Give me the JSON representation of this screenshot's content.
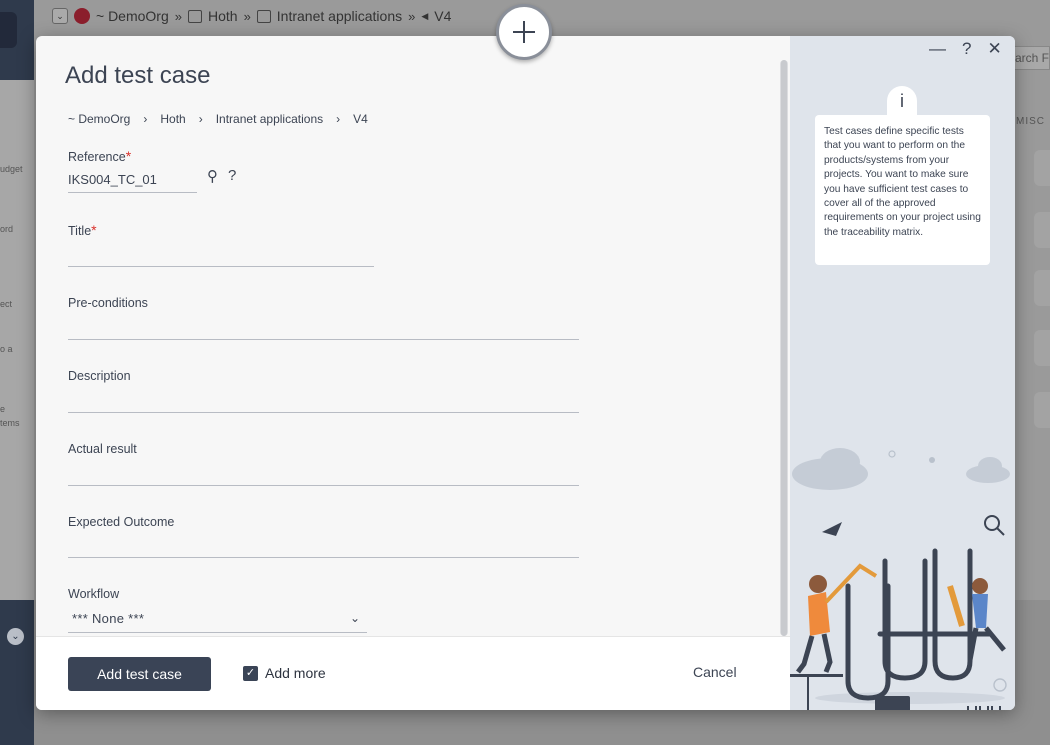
{
  "background": {
    "breadcrumb": [
      "~ DemoOrg",
      "Hoth",
      "Intranet applications",
      "V4"
    ],
    "separators": [
      "»",
      "»",
      "»"
    ],
    "search_partial": "arch F",
    "misc_label": "MISC",
    "side_labels": [
      "udget",
      "ord",
      "ect",
      "o a",
      "e",
      "tems"
    ]
  },
  "modal": {
    "title": "Add test case",
    "breadcrumb": [
      "~ DemoOrg",
      "Hoth",
      "Intranet applications",
      "V4"
    ],
    "fields": {
      "reference": {
        "label": "Reference",
        "value": "IKS004_TC_01"
      },
      "title": {
        "label": "Title",
        "value": ""
      },
      "preconditions": {
        "label": "Pre-conditions",
        "value": ""
      },
      "description": {
        "label": "Description",
        "value": ""
      },
      "actual_result": {
        "label": "Actual result",
        "value": ""
      },
      "expected_outcome": {
        "label": "Expected Outcome",
        "value": ""
      },
      "workflow": {
        "label": "Workflow",
        "value": "*** None ***"
      }
    },
    "required_marker": "*",
    "footer": {
      "add_button": "Add test case",
      "add_more_label": "Add more",
      "add_more_checked": true,
      "cancel": "Cancel"
    }
  },
  "help": {
    "info_glyph": "i",
    "text": "Test cases define specific tests that you want to perform on the products/systems from your projects. You want to make sure you have sufficient test cases to cover all of the approved requirements on your project using the traceability matrix.",
    "controls": {
      "minimize": "—",
      "help": "?",
      "close": "✕"
    }
  },
  "colors": {
    "primary_button": "#3a4456",
    "required": "#d9312b",
    "help_panel": "#dfe4eb"
  }
}
